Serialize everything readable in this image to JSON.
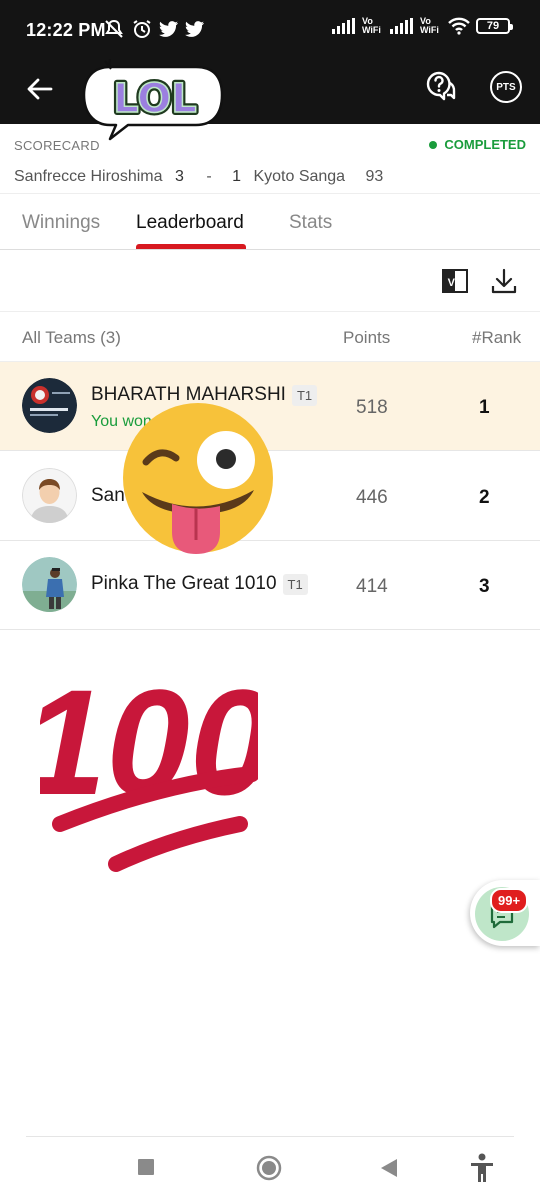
{
  "status_bar": {
    "time": "12:22 PM",
    "network_label_1": "Vo WiFi",
    "network_label_2": "Vo WiFi",
    "battery": "79"
  },
  "header": {
    "pts_label": "PTS"
  },
  "scorecard": {
    "label": "SCORECARD",
    "status": "COMPLETED",
    "home_team": "Sanfrecce Hiroshima",
    "home_score": "3",
    "separator": "-",
    "away_score": "1",
    "away_team": "Kyoto Sanga",
    "extra": "93",
    "status_color": "#1a9c3c"
  },
  "tabs": [
    {
      "label": "Winnings",
      "active": false
    },
    {
      "label": "Leaderboard",
      "active": true
    },
    {
      "label": "Stats",
      "active": false
    }
  ],
  "tools": {
    "vs_label": "VS"
  },
  "list_header": {
    "teams": "All Teams (3)",
    "points": "Points",
    "rank": "#Rank"
  },
  "rows": [
    {
      "name": "BHARATH MAHARSHI",
      "team_tag": "T1",
      "sub": "You won",
      "points": "518",
      "rank": "1",
      "highlight": true
    },
    {
      "name": "San",
      "team_tag": "",
      "sub": "",
      "points": "446",
      "rank": "2",
      "highlight": false
    },
    {
      "name": "Pinka The Great 1010",
      "team_tag": "T1",
      "sub": "",
      "points": "414",
      "rank": "3",
      "highlight": false
    }
  ],
  "stickers": {
    "lol_text": "LOL",
    "hundred_text": "100"
  },
  "chat_fab": {
    "badge": "99+"
  },
  "colors": {
    "accent_red": "#d71920",
    "success_green": "#1a9c3c",
    "highlight_row": "#fdf3e1",
    "appbar_bg": "#141414"
  }
}
